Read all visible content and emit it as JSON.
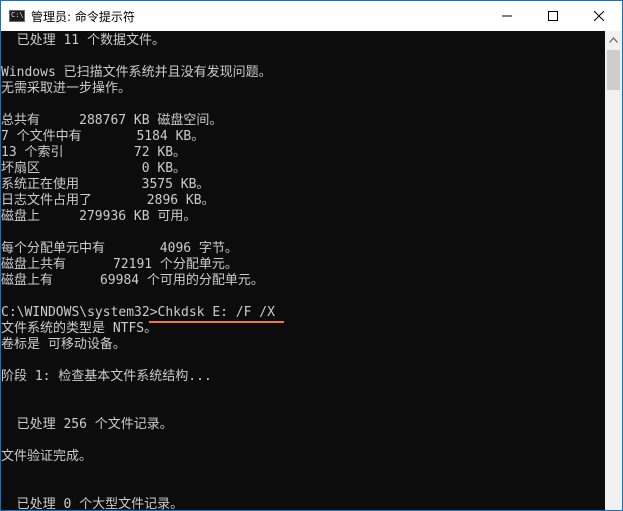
{
  "window": {
    "title": "管理员: 命令提示符"
  },
  "icons": {
    "app": "cmd-app-icon",
    "minimize": "minimize-icon",
    "maximize": "maximize-icon",
    "close": "close-icon",
    "scroll_up": "chevron-up-icon"
  },
  "colors": {
    "console_bg": "#0c0c0c",
    "console_text": "#cccccc",
    "underline": "#f07c2a"
  },
  "console": {
    "lines": [
      "  已处理 11 个数据文件。",
      "",
      "Windows 已扫描文件系统并且没有发现问题。",
      "无需采取进一步操作。",
      "",
      "总共有     288767 KB 磁盘空间。",
      "7 个文件中有       5184 KB。",
      "13 个索引         72 KB。",
      "坏扇区             0 KB。",
      "系统正在使用        3575 KB。",
      "日志文件占用了       2896 KB。",
      "磁盘上     279936 KB 可用。",
      "",
      "每个分配单元中有       4096 字节。",
      "磁盘上共有      72191 个分配单元。",
      "磁盘上有      69984 个可用的分配单元。",
      "",
      "C:\\WINDOWS\\system32>Chkdsk E: /F /X",
      "文件系统的类型是 NTFS。",
      "卷标是 可移动设备。",
      "",
      "阶段 1: 检查基本文件系统结构...",
      "",
      "",
      "  已处理 256 个文件记录。",
      "",
      "文件验证完成。",
      "",
      "",
      "  已处理 0 个大型文件记录。"
    ]
  }
}
